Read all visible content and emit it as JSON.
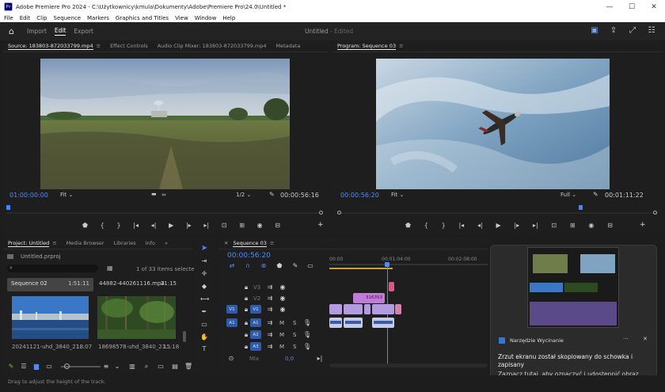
{
  "titlebar": {
    "title": "Adobe Premiere Pro 2024 - C:\\Użytkownicy\\kmula\\Dokumenty\\Adobe\\Premiere Pro\\24.0\\Untitled *",
    "logo": "Pr",
    "min": "—",
    "max": "☐",
    "close": "✕"
  },
  "menu": [
    "File",
    "Edit",
    "Clip",
    "Sequence",
    "Markers",
    "Graphics and Titles",
    "View",
    "Window",
    "Help"
  ],
  "workspace": {
    "tabs": [
      "Import",
      "Edit",
      "Export"
    ],
    "active_tab": "Edit",
    "doc_title": "Untitled",
    "doc_status": "- Edited"
  },
  "source_panel": {
    "tabs": [
      "Source: 183803-872033799.mp4",
      "Effect Controls",
      "Audio Clip Mixer: 183803-872033799.mp4",
      "Metadata"
    ],
    "menu_icon": "≡",
    "timecode_in": "01:00:00:00",
    "fit": "Fit",
    "fraction": "1/2",
    "duration": "00:00:56:16"
  },
  "program_panel": {
    "tab": "Program: Sequence 03",
    "menu_icon": "≡",
    "timecode": "00:00:56:20",
    "fit": "Fit",
    "quality": "Full",
    "duration": "00:01:11:22"
  },
  "project_panel": {
    "tabs": [
      "Project: Untitled",
      "Media Browser",
      "Libraries",
      "Info"
    ],
    "more": "»",
    "bin": "Untitled.prproj",
    "selection_info": "1 of 33 items selected",
    "items": [
      {
        "name": "Sequence 02",
        "duration": "1:51:11"
      },
      {
        "name": "44882-440261116.mp4",
        "duration": "21:15"
      },
      {
        "name": "20241121-uhd_3840_21...",
        "duration": "18:07"
      },
      {
        "name": "18698578-uhd_3840_21...",
        "duration": "15:18"
      }
    ]
  },
  "timeline": {
    "tab": "Sequence 03",
    "timecode": "00:00:56:20",
    "ruler": [
      "00:00",
      "00:01:04:00",
      "00:02:08:00"
    ],
    "video_tracks": [
      "V3",
      "V2",
      "V1"
    ],
    "audio_tracks": [
      "A1",
      "A2",
      "A3"
    ],
    "source_v": "V1",
    "source_a": "A1",
    "mix_label": "Mix",
    "mix_value": "0,0",
    "clip_label_v2": "316353"
  },
  "notification": {
    "app": "Narzędzie Wycinanie",
    "more": "···",
    "close": "✕",
    "line1": "Zrzut ekranu został skopiowany do schowka i zapisany",
    "line2": "Zaznacz tutaj, aby oznaczyć i udostępnić obraz"
  },
  "status": {
    "text": "Drag to adjust the height of the track."
  },
  "colors": {
    "accent": "#4a8cff",
    "clip_video": "#9a9ad6",
    "clip_v2": "#c07cd6",
    "clip_pink": "#e0548c",
    "audio_track_btn": "#2f5ba8"
  }
}
